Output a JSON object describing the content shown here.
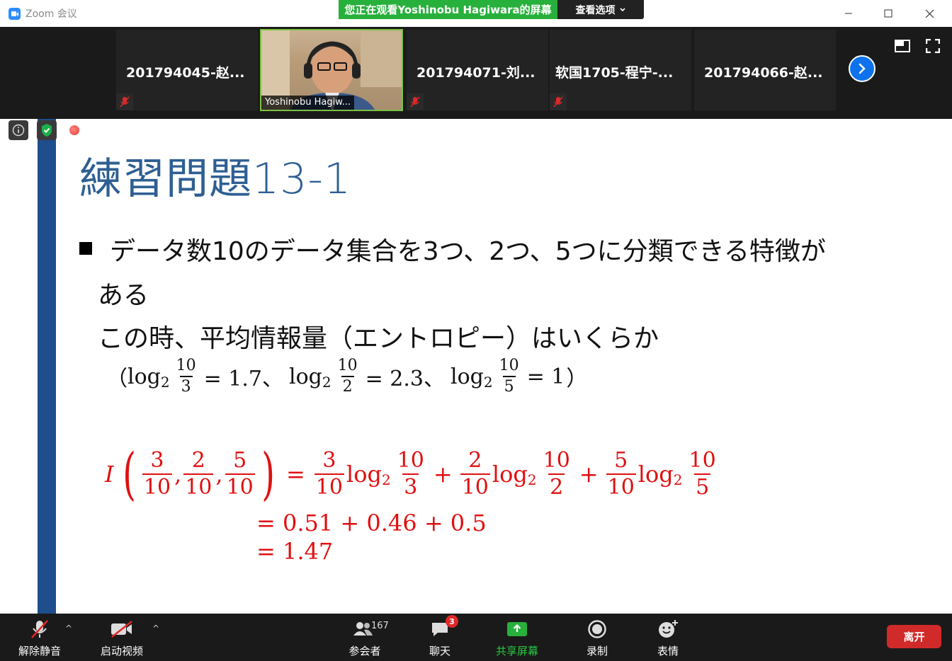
{
  "window": {
    "app_title": "Zoom 会议",
    "share_banner": "您正在观看Yoshinobu Hagiwara的屏幕",
    "view_options": "查看选项"
  },
  "participants": [
    {
      "name": "201794045-赵...",
      "muted": true
    },
    {
      "name": "Yoshinobu Hagiw...",
      "video": true
    },
    {
      "name": "201794071-刘...",
      "muted": true
    },
    {
      "name": "软国1705-程宁-...",
      "muted": true
    },
    {
      "name": "201794066-赵..."
    }
  ],
  "slide": {
    "title": "練習問題13-1",
    "bullet_line1": "データ数10のデータ集合を3つ、2つ、5つに分類できる特徴が",
    "bullet_line2": "ある",
    "bullet_line3": "この時、平均情報量（エントロピー）はいくらか",
    "given": {
      "open": "（",
      "log": "log",
      "base": "2",
      "f1_num": "10",
      "f1_den": "3",
      "v1": "= 1.7、",
      "f2_num": "10",
      "f2_den": "2",
      "v2": "= 2.3、",
      "f3_num": "10",
      "f3_den": "5",
      "v3": "= 1",
      "close": "）"
    },
    "answer": {
      "fn": "I",
      "args": [
        [
          "3",
          "10"
        ],
        [
          "2",
          "10"
        ],
        [
          "5",
          "10"
        ]
      ],
      "eq": "=",
      "terms": [
        [
          "3",
          "10",
          "10",
          "3"
        ],
        [
          "2",
          "10",
          "10",
          "2"
        ],
        [
          "5",
          "10",
          "10",
          "5"
        ]
      ],
      "plus": "+",
      "line2": "= 0.51 + 0.46 + 0.5",
      "line3": "= 1.47"
    }
  },
  "toolbar": {
    "unmute": "解除静音",
    "start_video": "启动视频",
    "participants": "参会者",
    "participants_count": "167",
    "chat": "聊天",
    "chat_badge": "3",
    "share": "共享屏幕",
    "record": "录制",
    "reactions": "表情",
    "leave": "离开"
  },
  "colors": {
    "share_green": "#28b03c",
    "slide_blue": "#1f4e8c",
    "title_blue": "#2e5f93",
    "answer_red": "#e01010",
    "leave_red": "#d12a2a"
  }
}
